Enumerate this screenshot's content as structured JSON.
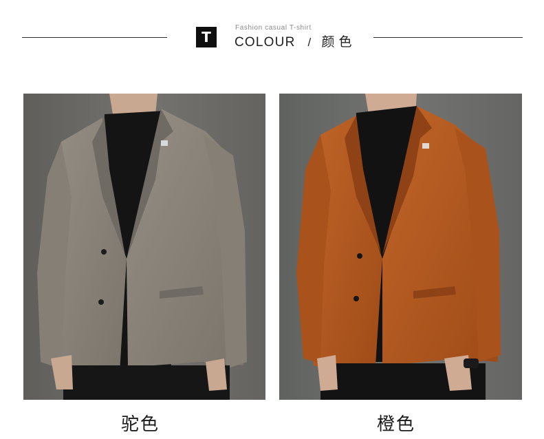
{
  "header": {
    "icon_letter": "T",
    "subtitle": "Fashion casual T-shirt",
    "title_en": "COLOUR",
    "separator": "/",
    "title_cn": "颜色"
  },
  "products": [
    {
      "caption": "驼色",
      "image": "gray-wool-blazer-photo",
      "coat_color": "#8b857c"
    },
    {
      "caption": "橙色",
      "image": "orange-wool-blazer-photo",
      "coat_color": "#b35a22"
    }
  ]
}
